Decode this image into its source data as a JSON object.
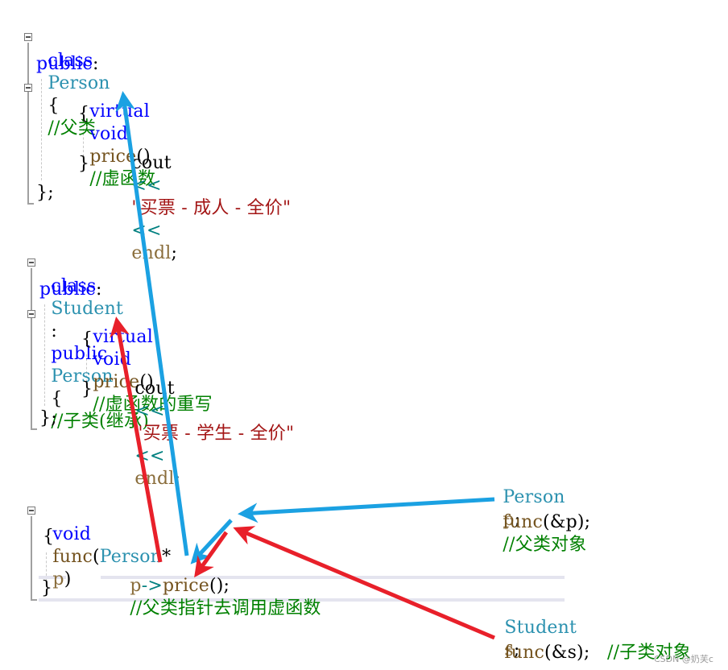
{
  "person_class": {
    "line1": {
      "kw": "class",
      "name": "Person",
      "brace": "{",
      "comment": "//父类"
    },
    "line2": {
      "kw": "public",
      "colon": ":"
    },
    "line3": {
      "kw1": "virtual",
      "kw2": "void",
      "fn": "price",
      "parens": "()",
      "comment": "//虚函数"
    },
    "open_brace": "{",
    "body": {
      "ident": "cout",
      "op1": "<<",
      "str": "\"买票 - 成人 - 全价\"",
      "op2": "<<",
      "endl": "endl",
      "semi": ";"
    },
    "close_brace": "}",
    "end": "};"
  },
  "student_class": {
    "line1": {
      "kw": "class",
      "name": "Student",
      "colon": ":",
      "kw2": "public",
      "base": "Person",
      "brace": "{",
      "comment": "//子类(继承)"
    },
    "line2": {
      "kw": "public",
      "colon": ":"
    },
    "line3": {
      "kw1": "virtual",
      "kw2": "void",
      "fn": "price",
      "parens": "()",
      "comment": "//虚函数的重写"
    },
    "open_brace": "{",
    "body": {
      "ident": "cout",
      "op1": "<<",
      "str": "\"买票 - 学生 - 全价\"",
      "op2": "<<",
      "endl": "endl",
      "semi": ";"
    },
    "close_brace": "}",
    "end": "};"
  },
  "func": {
    "line1": {
      "kw": "void",
      "fn": "func",
      "open": "(",
      "type": "Person",
      "star": "*",
      "param": "p",
      "close": ")"
    },
    "open_brace": "{",
    "body": {
      "p": "p",
      "arrow": "->",
      "call": "price",
      "rest": "();",
      "comment": "//父类指针去调用虚函数"
    },
    "close_brace": "}"
  },
  "parent_call": {
    "decl": {
      "type": "Person",
      "var": "p",
      "semi": ";"
    },
    "call": {
      "fn": "func",
      "args": "(&p);",
      "comment": "//父类对象"
    }
  },
  "child_call": {
    "decl": {
      "type": "Student",
      "var": "s",
      "semi": ";"
    },
    "call": {
      "fn": "func",
      "args": "(&s);",
      "comment": "//子类对象"
    }
  },
  "annotations": {
    "blue_color": "#1ba1e2",
    "red_color": "#e8202a"
  },
  "watermark": "CSDN @奶芙c"
}
